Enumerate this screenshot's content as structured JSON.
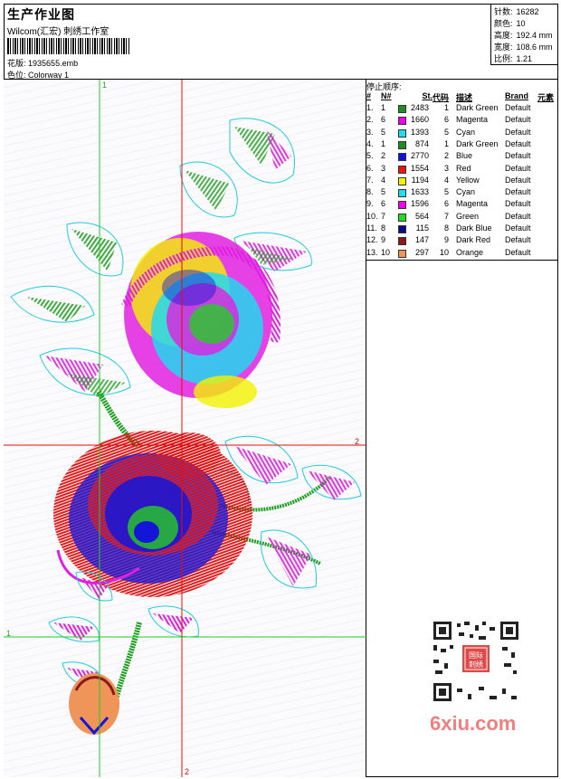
{
  "header": {
    "title": "生产作业图",
    "studio": "Wilcom(汇宏) 刺绣工作室",
    "design_label": "花版:",
    "design_value": "1935655.emb",
    "colorway_label": "色位:",
    "colorway_value": "Colorway 1"
  },
  "stats": [
    {
      "label": "针数:",
      "value": "16282"
    },
    {
      "label": "颜色:",
      "value": "10"
    },
    {
      "label": "高度:",
      "value": "192.4 mm"
    },
    {
      "label": "宽度:",
      "value": "108.6 mm"
    },
    {
      "label": "比例:",
      "value": "1.21"
    }
  ],
  "stop_sequence": {
    "title": "停止顺序:",
    "columns": [
      "#",
      "N#",
      "St.",
      "代码",
      "描述",
      "Brand",
      "元素"
    ],
    "rows": [
      {
        "step": "1.",
        "n": "1",
        "color": "#228b22",
        "st": "2483",
        "code": "1",
        "desc": "Dark Green",
        "brand": "Default"
      },
      {
        "step": "2.",
        "n": "6",
        "color": "#ee00ee",
        "st": "1660",
        "code": "6",
        "desc": "Magenta",
        "brand": "Default"
      },
      {
        "step": "3.",
        "n": "5",
        "color": "#22ddee",
        "st": "1393",
        "code": "5",
        "desc": "Cyan",
        "brand": "Default"
      },
      {
        "step": "4.",
        "n": "1",
        "color": "#228b22",
        "st": "874",
        "code": "1",
        "desc": "Dark Green",
        "brand": "Default"
      },
      {
        "step": "5.",
        "n": "2",
        "color": "#1010dd",
        "st": "2770",
        "code": "2",
        "desc": "Blue",
        "brand": "Default"
      },
      {
        "step": "6.",
        "n": "3",
        "color": "#ee1111",
        "st": "1554",
        "code": "3",
        "desc": "Red",
        "brand": "Default"
      },
      {
        "step": "7.",
        "n": "4",
        "color": "#f2f200",
        "st": "1194",
        "code": "4",
        "desc": "Yellow",
        "brand": "Default"
      },
      {
        "step": "8.",
        "n": "5",
        "color": "#22ddee",
        "st": "1633",
        "code": "5",
        "desc": "Cyan",
        "brand": "Default"
      },
      {
        "step": "9.",
        "n": "6",
        "color": "#ee00ee",
        "st": "1596",
        "code": "6",
        "desc": "Magenta",
        "brand": "Default"
      },
      {
        "step": "10.",
        "n": "7",
        "color": "#22dd22",
        "st": "564",
        "code": "7",
        "desc": "Green",
        "brand": "Default"
      },
      {
        "step": "11.",
        "n": "8",
        "color": "#0a0a88",
        "st": "115",
        "code": "8",
        "desc": "Dark Blue",
        "brand": "Default"
      },
      {
        "step": "12.",
        "n": "9",
        "color": "#8b1a1a",
        "st": "147",
        "code": "9",
        "desc": "Dark Red",
        "brand": "Default"
      },
      {
        "step": "13.",
        "n": "10",
        "color": "#f0955a",
        "st": "297",
        "code": "10",
        "desc": "Orange",
        "brand": "Default"
      }
    ]
  },
  "guides": {
    "v1": "1",
    "h2_right": "2",
    "h1_left": "1",
    "v2_bottom": "2"
  },
  "watermark": "6xiu.com",
  "qr_stamp": "国际刺绣"
}
